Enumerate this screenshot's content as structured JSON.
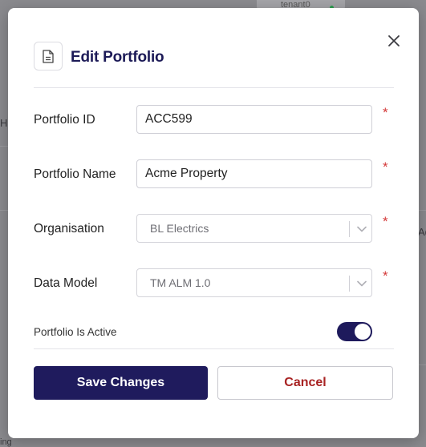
{
  "background": {
    "tab_label": "tenant0",
    "edge_letter_left": "H",
    "edge_letter_right": "Ad",
    "edge_text_bottom": "ing"
  },
  "modal": {
    "title": "Edit Portfolio",
    "header_icon": "document-icon",
    "close_icon": "close-icon",
    "fields": {
      "portfolio_id": {
        "label": "Portfolio ID",
        "value": "ACC599",
        "required": "*"
      },
      "portfolio_name": {
        "label": "Portfolio Name",
        "value": "Acme Property",
        "required": "*"
      },
      "organisation": {
        "label": "Organisation",
        "value": "BL Electrics",
        "required": "*"
      },
      "data_model": {
        "label": "Data Model",
        "value": "TM ALM 1.0",
        "required": "*"
      }
    },
    "active_toggle": {
      "label": "Portfolio Is Active",
      "state": "on"
    },
    "buttons": {
      "save": "Save Changes",
      "cancel": "Cancel"
    }
  },
  "colors": {
    "primary": "#1f1b5d",
    "cancel_text": "#a82323",
    "required": "#d43a3a"
  }
}
